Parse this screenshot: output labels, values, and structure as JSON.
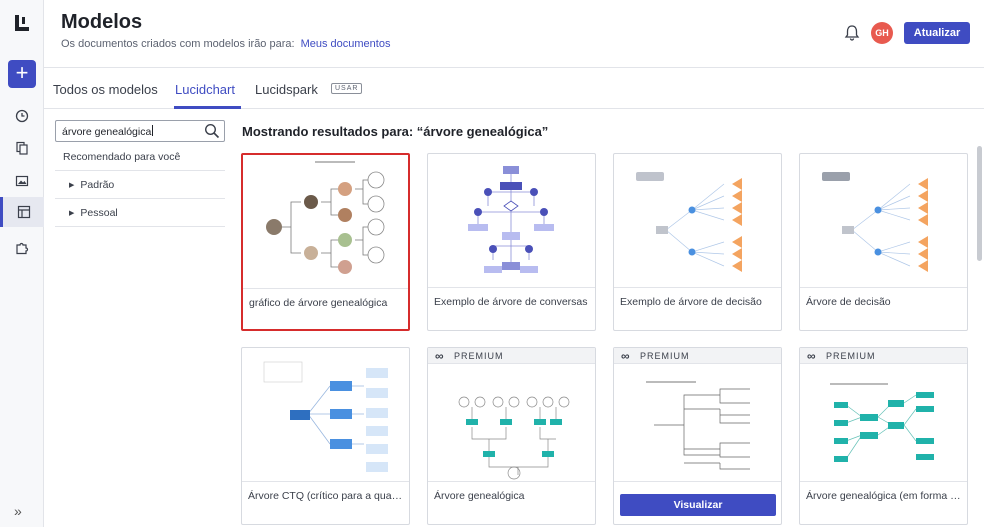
{
  "header": {
    "title": "Modelos",
    "subtitle": "Os documentos criados com modelos irão para:",
    "subtitle_link": "Meus documentos",
    "avatar_initials": "GH",
    "update_label": "Atualizar"
  },
  "rail": {
    "plus": "+",
    "collapse": "»"
  },
  "tabs": [
    {
      "label": "Todos os modelos",
      "active": false
    },
    {
      "label": "Lucidchart",
      "active": true
    },
    {
      "label": "Lucidspark",
      "active": false,
      "badge": "USAR"
    }
  ],
  "filter": {
    "search_value": "árvore genealógica",
    "recommended": "Recomendado para você",
    "categories": [
      "Padrão",
      "Pessoal"
    ]
  },
  "results_heading": "Mostrando resultados para: “árvore genealógica”",
  "cards": [
    {
      "label": "gráfico de árvore genealógica",
      "premium": false,
      "selected": true
    },
    {
      "label": "Exemplo de árvore de conversas",
      "premium": false
    },
    {
      "label": "Exemplo de árvore de decisão",
      "premium": false
    },
    {
      "label": "Árvore de decisão",
      "premium": false
    },
    {
      "label": "Árvore CTQ (crítico para a qualidade)",
      "premium": false
    },
    {
      "label": "Árvore genealógica",
      "premium": true
    },
    {
      "label": "",
      "premium": true,
      "button": "Visualizar"
    },
    {
      "label": "Árvore genealógica (em forma de diagrama)",
      "premium": true
    }
  ],
  "premium_label": "PREMIUM",
  "colors": {
    "accent": "#3f4cc2",
    "selected_border": "#d62c2c",
    "avatar": "#e85a4f"
  }
}
